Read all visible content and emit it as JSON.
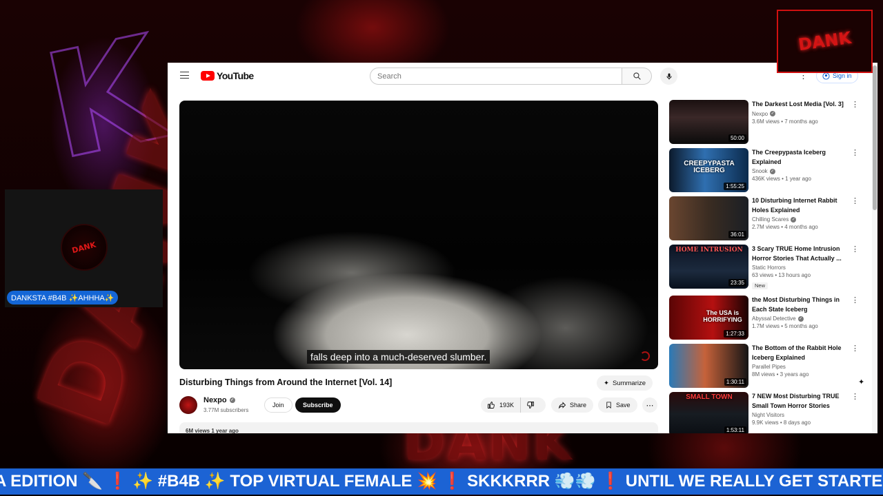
{
  "overlay": {
    "cam_name": "DANKSTA #B4B ✨AHHHA✨",
    "ticker": "A EDITION 🔪 ❗ ✨ #B4B ✨ TOP VIRTUAL FEMALE 💥 ❗ SKKKRRR 💨💨 ❗ UNTIL WE REALLY GET STARTED"
  },
  "youtube": {
    "logo_text": "YouTube",
    "search_placeholder": "Search",
    "sign_in_label": "Sign in",
    "caption": "falls deep into a much-deserved slumber.",
    "video_title": "Disturbing Things from Around the Internet [Vol. 14]",
    "summarize_label": "Summarize",
    "channel_name": "Nexpo",
    "subscribers": "3.77M subscribers",
    "join_label": "Join",
    "subscribe_label": "Subscribe",
    "likes": "193K",
    "share_label": "Share",
    "save_label": "Save",
    "description_meta": "6M views 1 year ago"
  },
  "recommendations": [
    {
      "title": "The Darkest Lost Media [Vol. 3]",
      "channel": "Nexpo",
      "verified": true,
      "meta": "3.6M views • 7 months ago",
      "duration": "50:00",
      "thumb_text": "",
      "badge": ""
    },
    {
      "title": "The Creepypasta Iceberg Explained",
      "channel": "Snook",
      "verified": true,
      "meta": "436K views • 1 year ago",
      "duration": "1:55:25",
      "thumb_text": "CREEPYPASTA ICEBERG",
      "badge": ""
    },
    {
      "title": "10 Disturbing Internet Rabbit Holes Explained",
      "channel": "Chilling Scares",
      "verified": true,
      "meta": "2.7M views • 4 months ago",
      "duration": "36:01",
      "thumb_text": "",
      "badge": ""
    },
    {
      "title": "3 Scary TRUE Home Intrusion Horror Stories That Actually ...",
      "channel": "Static Horrors",
      "verified": false,
      "meta": "63 views • 13 hours ago",
      "duration": "23:35",
      "thumb_text": "HOME INTRUSION",
      "badge": "New"
    },
    {
      "title": "the Most Disturbing Things in Each State Iceberg",
      "channel": "Abyssal Detective",
      "verified": true,
      "meta": "1.7M views • 5 months ago",
      "duration": "1:27:33",
      "thumb_text": "The USA is HORRIFYING",
      "badge": ""
    },
    {
      "title": "The Bottom of the Rabbit Hole Iceberg Explained",
      "channel": "Parallel Pipes",
      "verified": false,
      "meta": "8M views • 3 years ago",
      "duration": "1:30:11",
      "thumb_text": "",
      "badge": ""
    },
    {
      "title": "7 NEW Most Disturbing TRUE Small Town Horror Stories",
      "channel": "Night Visitors",
      "verified": false,
      "meta": "9.9K views • 8 days ago",
      "duration": "1:53:11",
      "thumb_text": "SMALL TOWN",
      "badge": ""
    }
  ]
}
